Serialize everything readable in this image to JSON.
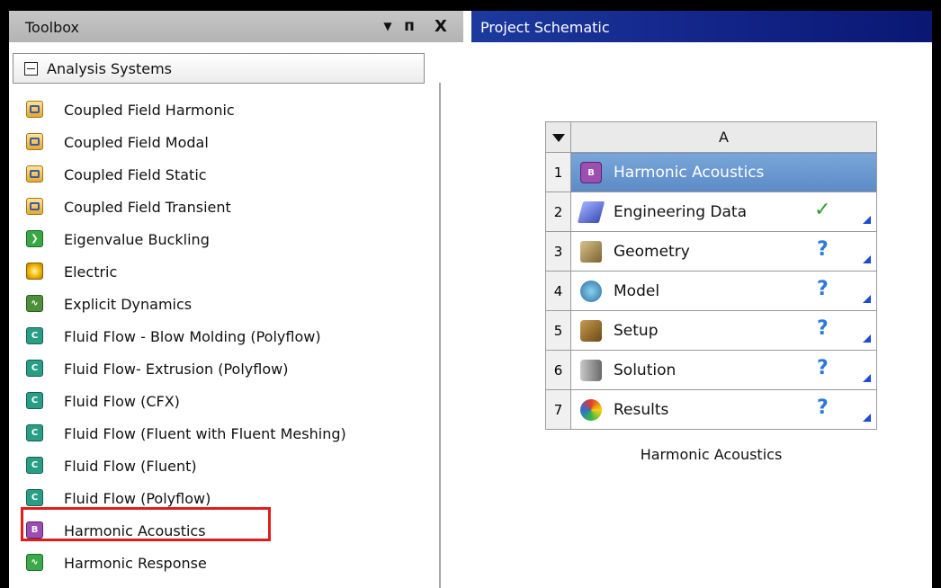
{
  "toolbox": {
    "title": "Toolbox",
    "controls": {
      "dropdown": "▼",
      "pin": "ᴨ",
      "close": "X"
    },
    "category": {
      "label": "Analysis Systems",
      "items": [
        {
          "label": "Coupled Field Harmonic",
          "icon": "coupled-field-icon"
        },
        {
          "label": "Coupled Field Modal",
          "icon": "coupled-field-icon"
        },
        {
          "label": "Coupled Field Static",
          "icon": "coupled-field-icon"
        },
        {
          "label": "Coupled Field Transient",
          "icon": "coupled-field-icon"
        },
        {
          "label": "Eigenvalue Buckling",
          "icon": "eigenvalue-icon"
        },
        {
          "label": "Electric",
          "icon": "electric-icon"
        },
        {
          "label": "Explicit Dynamics",
          "icon": "explicit-icon"
        },
        {
          "label": "Fluid Flow - Blow Molding (Polyflow)",
          "icon": "fluid-flow-icon"
        },
        {
          "label": "Fluid Flow- Extrusion (Polyflow)",
          "icon": "fluid-flow-icon"
        },
        {
          "label": "Fluid Flow (CFX)",
          "icon": "fluid-flow-icon"
        },
        {
          "label": "Fluid Flow (Fluent with Fluent Meshing)",
          "icon": "fluid-flow-icon"
        },
        {
          "label": "Fluid Flow (Fluent)",
          "icon": "fluid-flow-icon"
        },
        {
          "label": "Fluid Flow (Polyflow)",
          "icon": "fluid-flow-icon"
        },
        {
          "label": "Harmonic Acoustics",
          "icon": "harmonic-acoustics-icon"
        },
        {
          "label": "Harmonic Response",
          "icon": "harmonic-response-icon"
        }
      ]
    }
  },
  "schematic": {
    "title": "Project Schematic",
    "system": {
      "column": "A",
      "caption": "Harmonic Acoustics",
      "rows": [
        {
          "num": "1",
          "label": "Harmonic Acoustics",
          "icon": "harmonic-acoustics-icon",
          "status": ""
        },
        {
          "num": "2",
          "label": "Engineering Data",
          "icon": "engineering-data-icon",
          "status": "✓"
        },
        {
          "num": "3",
          "label": "Geometry",
          "icon": "geometry-icon",
          "status": "?"
        },
        {
          "num": "4",
          "label": "Model",
          "icon": "model-icon",
          "status": "?"
        },
        {
          "num": "5",
          "label": "Setup",
          "icon": "setup-icon",
          "status": "?"
        },
        {
          "num": "6",
          "label": "Solution",
          "icon": "solution-icon",
          "status": "?"
        },
        {
          "num": "7",
          "label": "Results",
          "icon": "results-icon",
          "status": "?"
        }
      ]
    }
  },
  "colors": {
    "schematic_header": "#14278c",
    "selected_row": "#5b8ac7",
    "highlight_box": "#e01c1c",
    "status_ok": "#2f9d2f",
    "status_attention": "#2b7bd6"
  }
}
